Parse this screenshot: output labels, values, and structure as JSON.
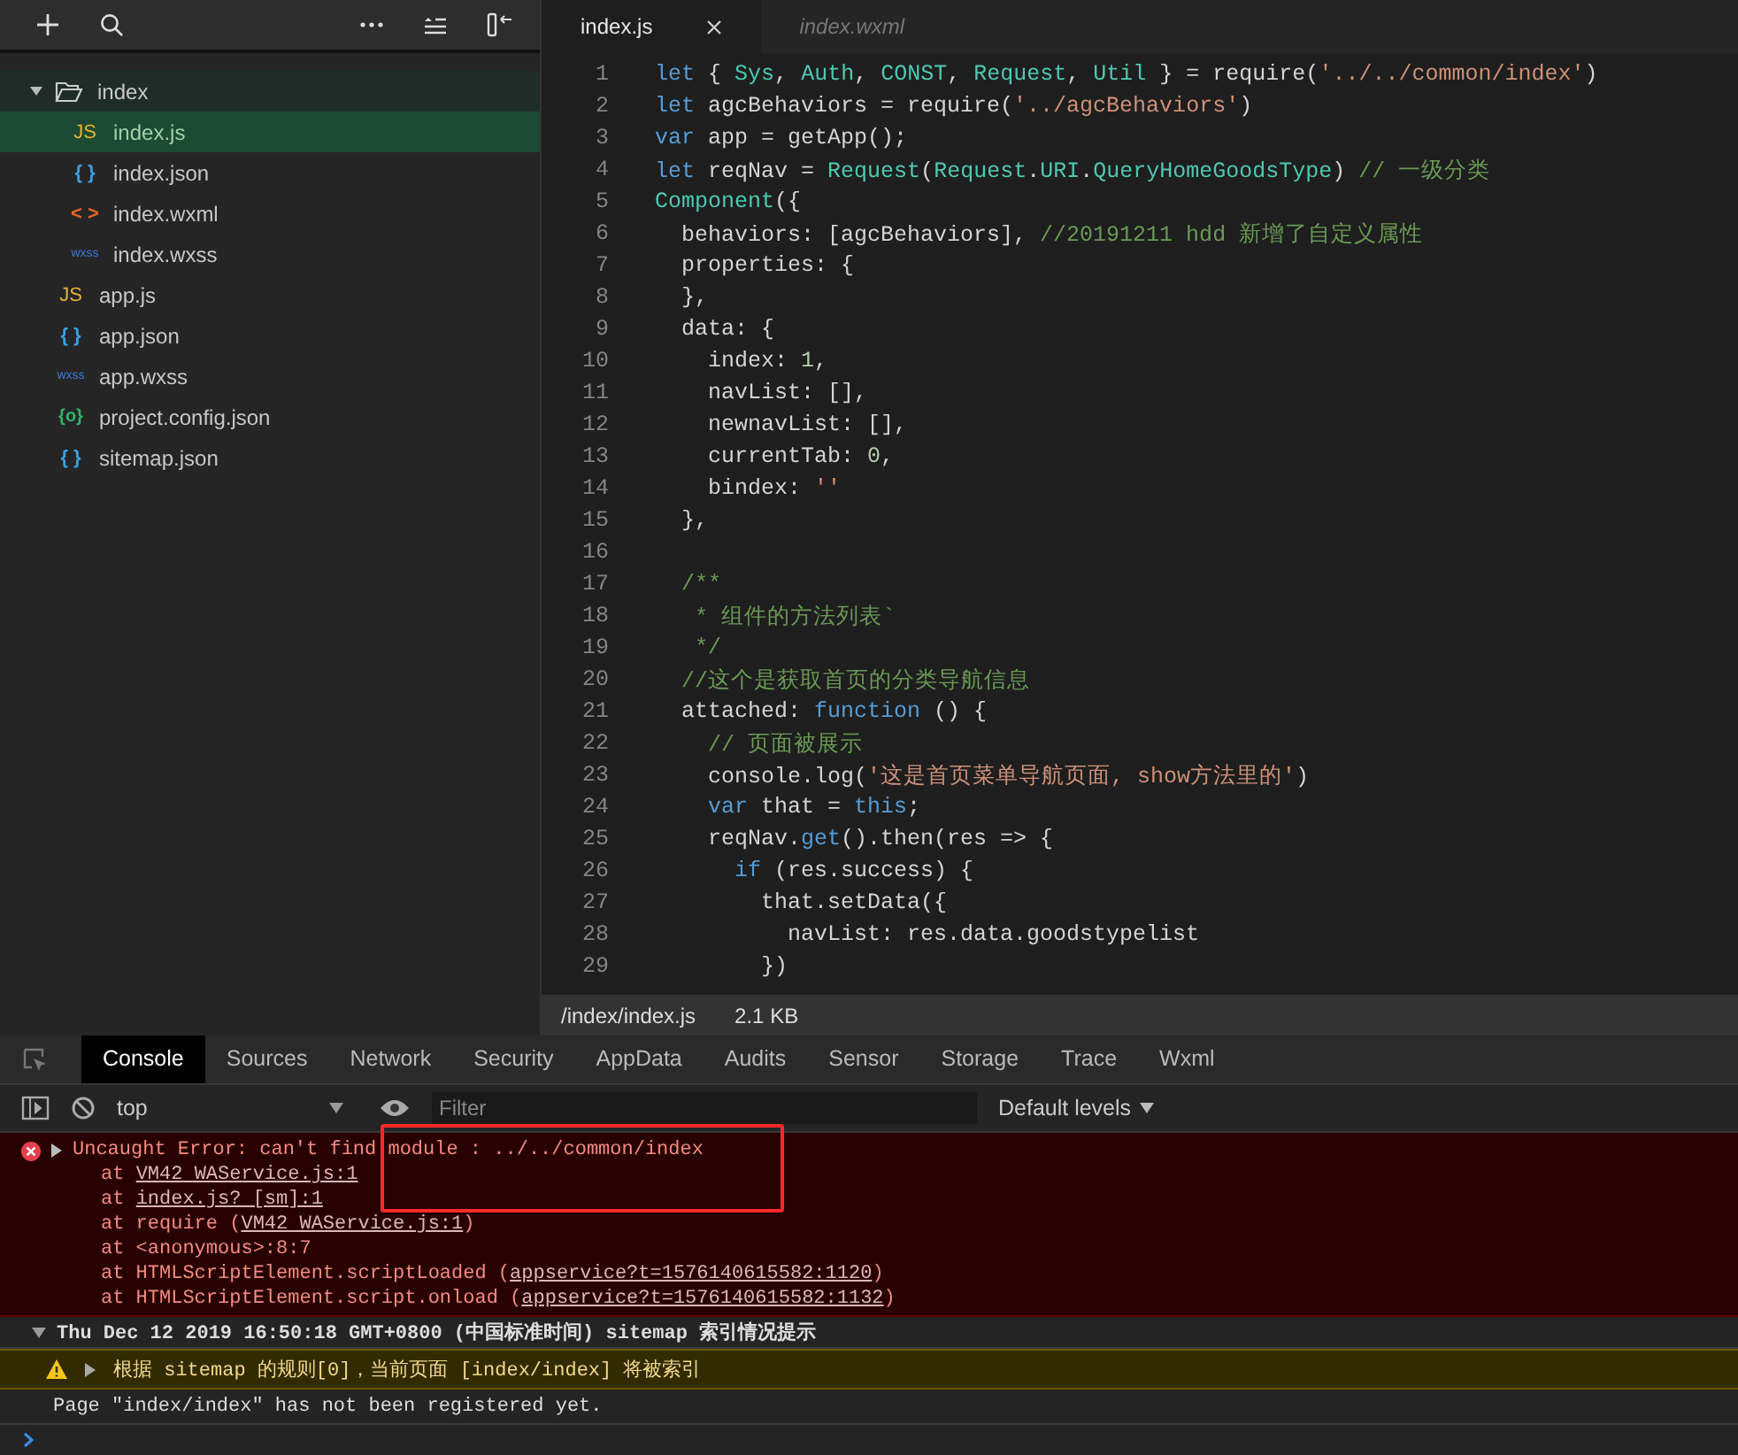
{
  "explorer": {
    "tree": [
      {
        "name": "index",
        "kind": "folder",
        "expanded": true,
        "selected": false,
        "children": [
          {
            "name": "index.js",
            "kind": "js",
            "badge": "JS",
            "selected": true
          },
          {
            "name": "index.json",
            "kind": "json",
            "badge": "{ }",
            "selected": false
          },
          {
            "name": "index.wxml",
            "kind": "wxml",
            "badge": "< >",
            "selected": false
          },
          {
            "name": "index.wxss",
            "kind": "wxss",
            "badge": "wxss",
            "selected": false
          }
        ]
      },
      {
        "name": "app.js",
        "kind": "js",
        "badge": "JS",
        "selected": false
      },
      {
        "name": "app.json",
        "kind": "json",
        "badge": "{ }",
        "selected": false
      },
      {
        "name": "app.wxss",
        "kind": "wxss",
        "badge": "wxss",
        "selected": false
      },
      {
        "name": "project.config.json",
        "kind": "config",
        "badge": "{o}",
        "selected": false
      },
      {
        "name": "sitemap.json",
        "kind": "json",
        "badge": "{ }",
        "selected": false
      }
    ]
  },
  "editor": {
    "tabs": [
      {
        "label": "index.js",
        "selected": true
      },
      {
        "label": "index.wxml",
        "selected": false
      }
    ],
    "lines": [
      {
        "n": "1",
        "tokens": [
          {
            "t": "let",
            "kind": "kw"
          },
          {
            "t": " { ",
            "kind": "p"
          },
          {
            "t": "Sys",
            "kind": "cls"
          },
          {
            "t": ", ",
            "kind": "p"
          },
          {
            "t": "Auth",
            "kind": "cls"
          },
          {
            "t": ", ",
            "kind": "p"
          },
          {
            "t": "CONST",
            "kind": "cls"
          },
          {
            "t": ", ",
            "kind": "p"
          },
          {
            "t": "Request",
            "kind": "cls"
          },
          {
            "t": ", ",
            "kind": "p"
          },
          {
            "t": "Util",
            "kind": "cls"
          },
          {
            "t": " } = require(",
            "kind": "p"
          },
          {
            "t": "'../../common/index'",
            "kind": "str"
          },
          {
            "t": ")",
            "kind": "p"
          }
        ]
      },
      {
        "n": "2",
        "tokens": [
          {
            "t": "let",
            "kind": "kw"
          },
          {
            "t": " agcBehaviors = require(",
            "kind": "p"
          },
          {
            "t": "'../agcBehaviors'",
            "kind": "str"
          },
          {
            "t": ")",
            "kind": "p"
          }
        ]
      },
      {
        "n": "3",
        "tokens": [
          {
            "t": "var",
            "kind": "kw"
          },
          {
            "t": " app = getApp();",
            "kind": "p"
          }
        ]
      },
      {
        "n": "4",
        "tokens": [
          {
            "t": "let",
            "kind": "kw"
          },
          {
            "t": " reqNav = ",
            "kind": "p"
          },
          {
            "t": "Request",
            "kind": "cls"
          },
          {
            "t": "(",
            "kind": "p"
          },
          {
            "t": "Request",
            "kind": "cls"
          },
          {
            "t": ".",
            "kind": "p"
          },
          {
            "t": "URI",
            "kind": "cls"
          },
          {
            "t": ".",
            "kind": "p"
          },
          {
            "t": "QueryHomeGoodsType",
            "kind": "cls"
          },
          {
            "t": ") ",
            "kind": "p"
          },
          {
            "t": "// 一级分类",
            "kind": "cmt"
          }
        ]
      },
      {
        "n": "5",
        "tokens": [
          {
            "t": "Component",
            "kind": "cls"
          },
          {
            "t": "({",
            "kind": "p"
          }
        ]
      },
      {
        "n": "6",
        "tokens": [
          {
            "t": "  behaviors: [agcBehaviors], ",
            "kind": "p"
          },
          {
            "t": "//20191211 hdd 新增了自定义属性",
            "kind": "cmt"
          }
        ]
      },
      {
        "n": "7",
        "tokens": [
          {
            "t": "  properties: {",
            "kind": "p"
          }
        ]
      },
      {
        "n": "8",
        "tokens": [
          {
            "t": "  },",
            "kind": "p"
          }
        ]
      },
      {
        "n": "9",
        "tokens": [
          {
            "t": "  data: {",
            "kind": "p"
          }
        ]
      },
      {
        "n": "10",
        "tokens": [
          {
            "t": "    index: ",
            "kind": "p"
          },
          {
            "t": "1",
            "kind": "num"
          },
          {
            "t": ",",
            "kind": "p"
          }
        ]
      },
      {
        "n": "11",
        "tokens": [
          {
            "t": "    navList: [],",
            "kind": "p"
          }
        ]
      },
      {
        "n": "12",
        "tokens": [
          {
            "t": "    newnavList: [],",
            "kind": "p"
          }
        ]
      },
      {
        "n": "13",
        "tokens": [
          {
            "t": "    currentTab: ",
            "kind": "p"
          },
          {
            "t": "0",
            "kind": "num"
          },
          {
            "t": ",",
            "kind": "p"
          }
        ]
      },
      {
        "n": "14",
        "tokens": [
          {
            "t": "    bindex: ",
            "kind": "p"
          },
          {
            "t": "''",
            "kind": "str"
          }
        ]
      },
      {
        "n": "15",
        "tokens": [
          {
            "t": "  },",
            "kind": "p"
          }
        ]
      },
      {
        "n": "16"
      },
      {
        "n": "17",
        "tokens": [
          {
            "t": "  /**",
            "kind": "cmt"
          }
        ]
      },
      {
        "n": "18",
        "tokens": [
          {
            "t": "   * 组件的方法列表`",
            "kind": "cmt"
          }
        ]
      },
      {
        "n": "19",
        "tokens": [
          {
            "t": "   */",
            "kind": "cmt"
          }
        ]
      },
      {
        "n": "20",
        "tokens": [
          {
            "t": "  //这个是获取首页的分类导航信息",
            "kind": "cmt"
          }
        ]
      },
      {
        "n": "21",
        "tokens": [
          {
            "t": "  attached: ",
            "kind": "p"
          },
          {
            "t": "function",
            "kind": "kw"
          },
          {
            "t": " () {",
            "kind": "p"
          }
        ]
      },
      {
        "n": "22",
        "tokens": [
          {
            "t": "    // 页面被展示",
            "kind": "cmt"
          }
        ]
      },
      {
        "n": "23",
        "tokens": [
          {
            "t": "    console.log(",
            "kind": "p"
          },
          {
            "t": "'这是首页菜单导航页面, show方法里的'",
            "kind": "str"
          },
          {
            "t": ")",
            "kind": "p"
          }
        ]
      },
      {
        "n": "24",
        "tokens": [
          {
            "t": "    var",
            "kind": "kw"
          },
          {
            "t": " that = ",
            "kind": "p"
          },
          {
            "t": "this",
            "kind": "kw"
          },
          {
            "t": ";",
            "kind": "p"
          }
        ]
      },
      {
        "n": "25",
        "tokens": [
          {
            "t": "    reqNav.",
            "kind": "p"
          },
          {
            "t": "get",
            "kind": "kw"
          },
          {
            "t": "().then(res => {",
            "kind": "p"
          }
        ]
      },
      {
        "n": "26",
        "tokens": [
          {
            "t": "      if",
            "kind": "kw"
          },
          {
            "t": " (res.success) {",
            "kind": "p"
          }
        ]
      },
      {
        "n": "27",
        "tokens": [
          {
            "t": "        that.setData({",
            "kind": "p"
          }
        ]
      },
      {
        "n": "28",
        "tokens": [
          {
            "t": "          navList: res.data.goodstypelist",
            "kind": "p"
          }
        ]
      },
      {
        "n": "29",
        "tokens": [
          {
            "t": "        })",
            "kind": "p"
          }
        ]
      }
    ],
    "status": {
      "path": "/index/index.js",
      "size": "2.1 KB"
    }
  },
  "devtools": {
    "tabs": [
      {
        "label": "Console",
        "selected": true
      },
      {
        "label": "Sources",
        "selected": false
      },
      {
        "label": "Network",
        "selected": false
      },
      {
        "label": "Security",
        "selected": false
      },
      {
        "label": "AppData",
        "selected": false
      },
      {
        "label": "Audits",
        "selected": false
      },
      {
        "label": "Sensor",
        "selected": false
      },
      {
        "label": "Storage",
        "selected": false
      },
      {
        "label": "Trace",
        "selected": false
      },
      {
        "label": "Wxml",
        "selected": false
      }
    ],
    "context": "top",
    "filter": {
      "placeholder": "Filter"
    },
    "levels": "Default levels",
    "messages": [
      {
        "kind": "error",
        "text": "Uncaught Error: can't find module : ../../common/index",
        "frames": [
          [
            {
              "t": "at "
            },
            {
              "t": "VM42 WAService.js:1",
              "link": true
            }
          ],
          [
            {
              "t": "at "
            },
            {
              "t": "index.js? [sm]:1",
              "link": true
            }
          ],
          [
            {
              "t": "at require ("
            },
            {
              "t": "VM42 WAService.js:1",
              "link": true
            },
            {
              "t": ")"
            }
          ],
          [
            {
              "t": "at <anonymous>:8:7"
            }
          ],
          [
            {
              "t": "at HTMLScriptElement.scriptLoaded ("
            },
            {
              "t": "appservice?t=1576140615582:1120",
              "link": true
            },
            {
              "t": ")"
            }
          ],
          [
            {
              "t": "at HTMLScriptElement.script.onload ("
            },
            {
              "t": "appservice?t=1576140615582:1132",
              "link": true
            },
            {
              "t": ")"
            }
          ]
        ]
      },
      {
        "kind": "group",
        "text": "Thu Dec 12 2019 16:50:18 GMT+0800 (中国标准时间) sitemap 索引情况提示",
        "expanded": true
      },
      {
        "kind": "warning",
        "text": "根据 sitemap 的规则[0]，当前页面 [index/index] 将被索引"
      },
      {
        "kind": "log",
        "text": "Page \"index/index\" has not been registered yet."
      }
    ]
  }
}
